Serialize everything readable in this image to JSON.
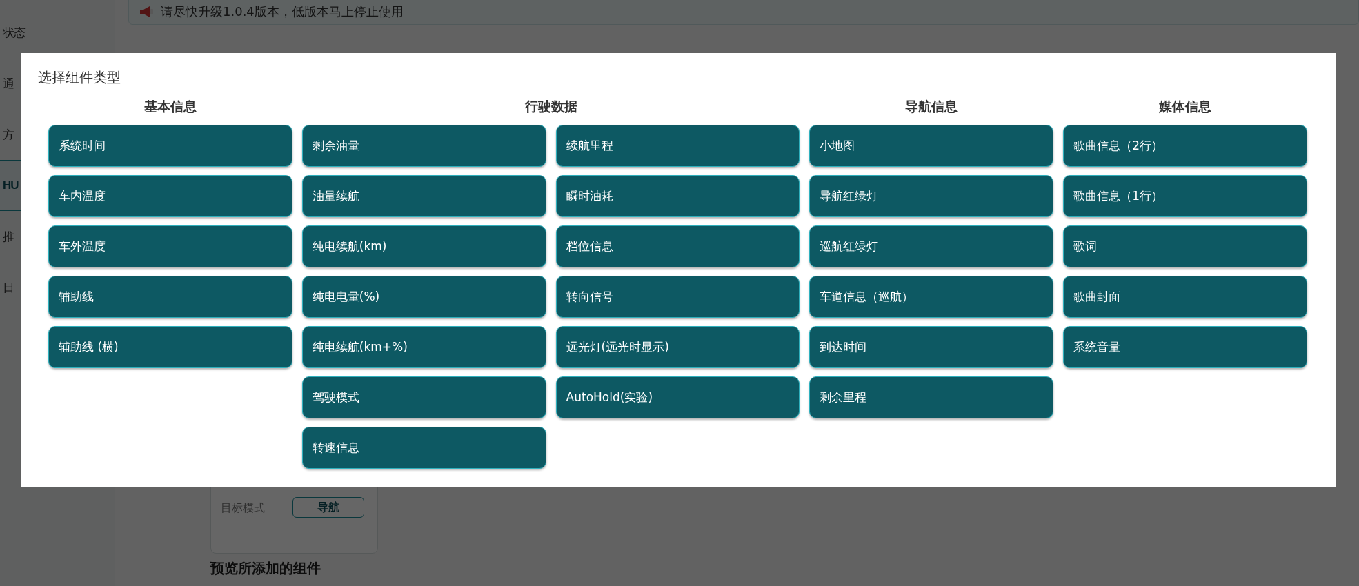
{
  "sidebar": {
    "items": [
      {
        "label": "状态",
        "selected": false
      },
      {
        "label": "通",
        "selected": false
      },
      {
        "label": "方",
        "selected": false
      },
      {
        "label": "HU",
        "selected": true
      },
      {
        "label": "推",
        "selected": false
      },
      {
        "label": "日",
        "selected": false
      }
    ]
  },
  "notice": {
    "text": "请尽快升级1.0.4版本，低版本马上停止使用"
  },
  "mode_card": {
    "label": "目标模式",
    "value": "导航"
  },
  "preview_heading": "预览所添加的组件",
  "dialog": {
    "title": "选择组件类型",
    "groups": [
      {
        "title": "基本信息",
        "columns": [
          [
            "系统时间",
            "车内温度",
            "车外温度",
            "辅助线",
            "辅助线 (横)"
          ]
        ]
      },
      {
        "title": "行驶数据",
        "columns": [
          [
            "剩余油量",
            "油量续航",
            "纯电续航(km)",
            "纯电电量(%)",
            "纯电续航(km+%)",
            "驾驶模式",
            "转速信息"
          ],
          [
            "续航里程",
            "瞬时油耗",
            "档位信息",
            "转向信号",
            "远光灯(远光时显示)",
            "AutoHold(实验)"
          ]
        ]
      },
      {
        "title": "导航信息",
        "columns": [
          [
            "小地图",
            "导航红绿灯",
            "巡航红绿灯",
            "车道信息（巡航）",
            "到达时间",
            "剩余里程"
          ]
        ]
      },
      {
        "title": "媒体信息",
        "columns": [
          [
            "歌曲信息（2行）",
            "歌曲信息（1行）",
            "歌词",
            "歌曲封面",
            "系统音量"
          ]
        ]
      }
    ]
  }
}
